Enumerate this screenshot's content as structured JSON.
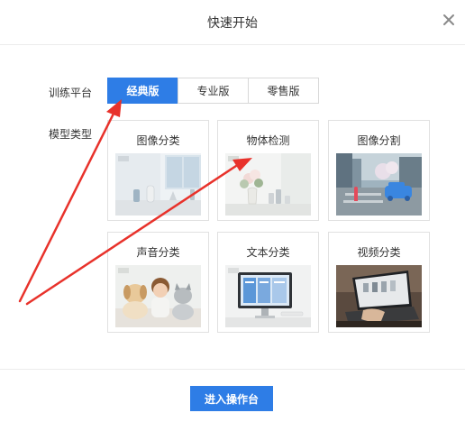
{
  "dialog": {
    "title": "快速开始",
    "close_icon": "close-icon"
  },
  "platform": {
    "label": "训练平台",
    "options": [
      "经典版",
      "专业版",
      "零售版"
    ],
    "selected": "经典版"
  },
  "model_types": {
    "label": "模型类型",
    "cards": [
      {
        "title": "图像分类",
        "image": "image-classification-thumbnail"
      },
      {
        "title": "物体检测",
        "image": "object-detection-thumbnail"
      },
      {
        "title": "图像分割",
        "image": "image-segmentation-thumbnail"
      },
      {
        "title": "声音分类",
        "image": "sound-classification-thumbnail"
      },
      {
        "title": "文本分类",
        "image": "text-classification-thumbnail"
      },
      {
        "title": "视频分类",
        "image": "video-classification-thumbnail"
      }
    ]
  },
  "footer": {
    "primary_label": "进入操作台"
  },
  "colors": {
    "accent": "#2e7de6",
    "annotation_arrow": "#e8322b",
    "border": "#e1e1e1"
  }
}
